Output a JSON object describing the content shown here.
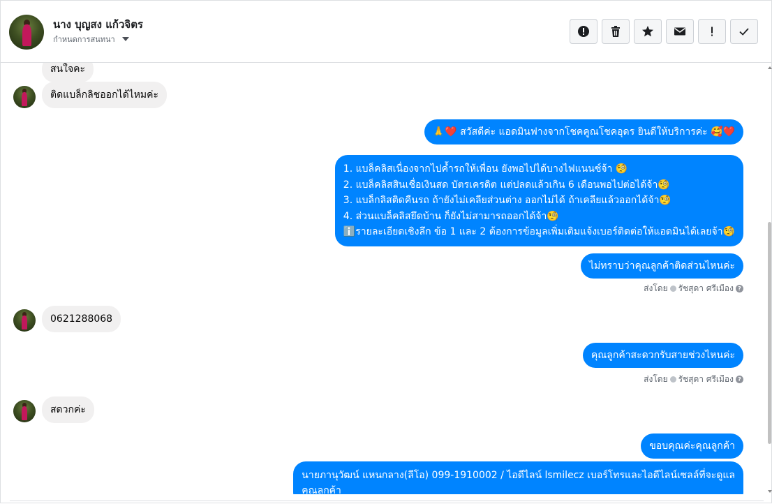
{
  "conversation": {
    "contact_name": "นาง บุญสง แก้วจิตร",
    "assign_label": "กำหนดการสนทนา"
  },
  "toolbar": {
    "buttons": [
      {
        "icon": "alert-circle-icon",
        "tooltip": ""
      },
      {
        "icon": "trash-icon",
        "tooltip": ""
      },
      {
        "icon": "star-icon",
        "tooltip": ""
      },
      {
        "icon": "envelope-icon",
        "tooltip": ""
      },
      {
        "icon": "exclamation-icon",
        "label": "!"
      },
      {
        "icon": "checkmark-icon",
        "tooltip": ""
      }
    ]
  },
  "messages": [
    {
      "direction": "in",
      "text": "สนใจคะ",
      "show_avatar": false
    },
    {
      "direction": "in",
      "text": "ติดแบล็กลิชออกได้ไหมค่ะ",
      "show_avatar": true
    },
    {
      "direction": "out",
      "text": "🙏❤️ สวัสดีค่ะ แอดมินฟางจากโชคคูณโชคอุดร ยินดีให้บริการค่ะ 🥰❤️"
    },
    {
      "direction": "out",
      "lines": [
        "1. แบล็คลิสเนื่องจากไปค้ำรถให้เพื่อน ยังพอไปได้บางไฟแนนซ์จ้า 🧐",
        "2. แบล็คลิสสินเชื่อเงินสด บัตรเครดิต แต่ปลดแล้วเกิน 6 เดือนพอไปต่อได้จ้า🧐",
        "3. แบล็กลิสติดคืนรถ ถ้ายังไม่เคลียส่วนต่าง ออกไม่ได้ ถ้าเคลียแล้วออกได้จ้า🧐",
        "4. ส่วนแบล็คลิสยึดบ้าน ก็ยังไม่สามารถออกได้จ้า🧐",
        "ℹ️รายละเอียดเชิงลึก ข้อ 1 และ 2 ต้องการข้อมูลเพิ่มเติมแจ้งเบอร์ติดต่อให้แอดมินได้เลยจ้า🧐"
      ]
    },
    {
      "direction": "out",
      "text": "ไม่ทราบว่าคุณลูกค้าติดส่วนไหนค่ะ",
      "sent_by_prefix": "ส่งโดย",
      "sent_by_name": "รัชสุดา ศรีเมือง"
    },
    {
      "direction": "in",
      "text": "0621288068",
      "show_avatar": true
    },
    {
      "direction": "out",
      "text": "คุณลูกค้าสะดวกรับสายช่วงไหนค่ะ",
      "sent_by_prefix": "ส่งโดย",
      "sent_by_name": "รัชสุดา ศรีเมือง"
    },
    {
      "direction": "in",
      "text": "สดวกค่ะ",
      "show_avatar": true
    },
    {
      "direction": "out",
      "text": "ขอบคุณค่ะคุณลูกค้า"
    },
    {
      "direction": "out",
      "lines": [
        "นายภานุวัฒน์ แหนกลาง(ลีโอ)      099-1910002 / ไอดีไลน์ lsmilecz   เบอร์โทรและไอดีไลน์เซลล์ที่จะดูแล",
        "คุณลูกค้า"
      ]
    }
  ],
  "colors": {
    "outgoing_bubble": "#0084ff",
    "incoming_bubble": "#f1f0f0",
    "secondary_text": "#606770"
  }
}
